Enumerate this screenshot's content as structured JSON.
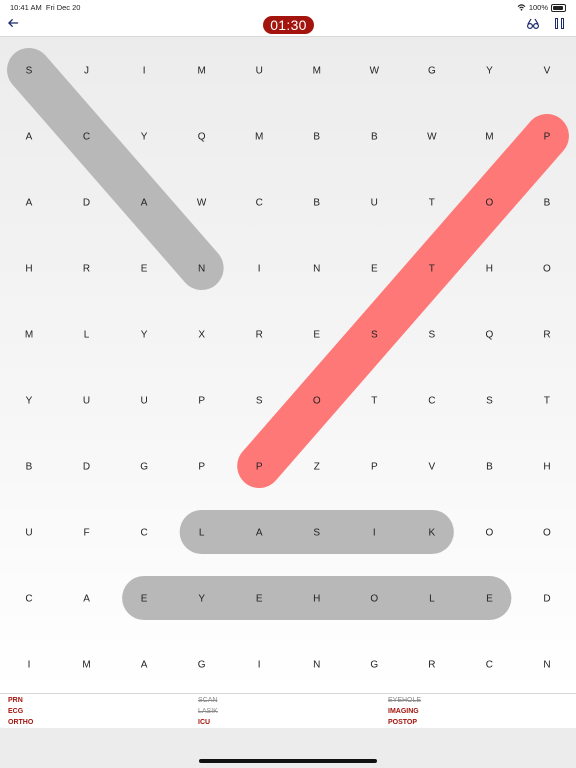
{
  "status_bar": {
    "time": "10:41 AM",
    "date": "Fri Dec 20",
    "battery": "100%"
  },
  "toolbar": {
    "back_icon": "arrow-left-icon",
    "timer": "01:30",
    "hint_icon": "hint-icon",
    "pause_icon": "pause-icon"
  },
  "grid": {
    "rows": [
      [
        "S",
        "J",
        "I",
        "M",
        "U",
        "M",
        "W",
        "G",
        "Y",
        "V"
      ],
      [
        "A",
        "C",
        "Y",
        "Q",
        "M",
        "B",
        "B",
        "W",
        "M",
        "P"
      ],
      [
        "A",
        "D",
        "A",
        "W",
        "C",
        "B",
        "U",
        "T",
        "O",
        "B"
      ],
      [
        "H",
        "R",
        "E",
        "N",
        "I",
        "N",
        "E",
        "T",
        "H",
        "O"
      ],
      [
        "M",
        "L",
        "Y",
        "X",
        "R",
        "E",
        "S",
        "S",
        "Q",
        "R"
      ],
      [
        "Y",
        "U",
        "U",
        "P",
        "S",
        "O",
        "T",
        "C",
        "S",
        "T"
      ],
      [
        "B",
        "D",
        "G",
        "P",
        "P",
        "Z",
        "P",
        "V",
        "B",
        "H"
      ],
      [
        "U",
        "F",
        "C",
        "L",
        "A",
        "S",
        "I",
        "K",
        "O",
        "O"
      ],
      [
        "C",
        "A",
        "E",
        "Y",
        "E",
        "H",
        "O",
        "L",
        "E",
        "D"
      ],
      [
        "I",
        "M",
        "A",
        "G",
        "I",
        "N",
        "G",
        "R",
        "C",
        "N"
      ]
    ],
    "selections": [
      {
        "from": [
          0,
          0
        ],
        "to": [
          3,
          3
        ],
        "color": "#b8b8b8"
      },
      {
        "from": [
          7,
          3
        ],
        "to": [
          7,
          7
        ],
        "color": "#b8b8b8"
      },
      {
        "from": [
          8,
          2
        ],
        "to": [
          8,
          8
        ],
        "color": "#b8b8b8"
      },
      {
        "from": [
          6,
          4
        ],
        "to": [
          1,
          9
        ],
        "color": "#ff7878"
      }
    ]
  },
  "word_list": [
    {
      "word": "PRN",
      "found": false
    },
    {
      "word": "SCAN",
      "found": true
    },
    {
      "word": "EYEHOLE",
      "found": true
    },
    {
      "word": "ECG",
      "found": false
    },
    {
      "word": "LASIK",
      "found": true
    },
    {
      "word": "IMAGING",
      "found": false
    },
    {
      "word": "ORTHO",
      "found": false
    },
    {
      "word": "ICU",
      "found": false
    },
    {
      "word": "POSTOP",
      "found": false
    }
  ],
  "colors": {
    "accent": "#a4140e",
    "found_highlight": "#b8b8b8",
    "active_highlight": "#ff7878"
  }
}
